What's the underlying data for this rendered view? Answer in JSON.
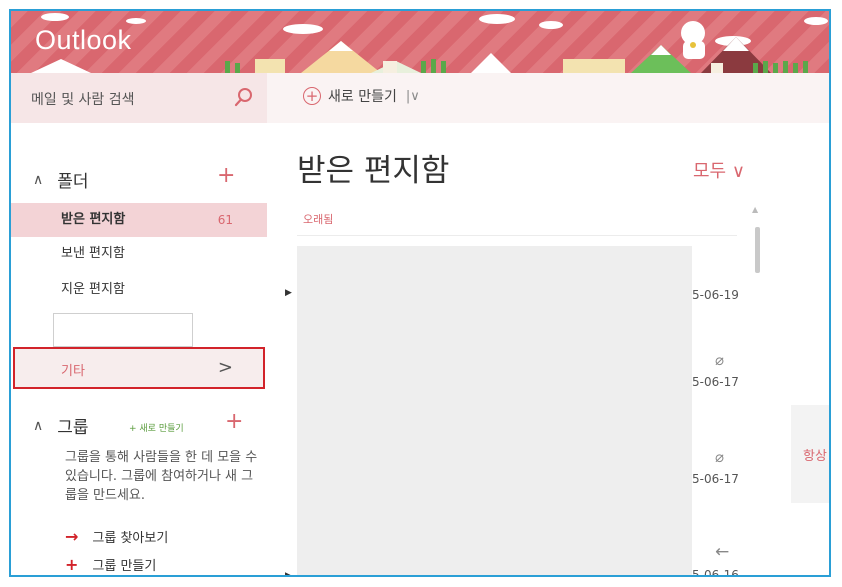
{
  "header": {
    "app_title": "Outlook"
  },
  "search": {
    "placeholder": "메일 및 사람 검색",
    "icon": "search-icon"
  },
  "toolbar": {
    "new_label": "새로 만들기"
  },
  "sidebar": {
    "folders_heading": "폴더",
    "folders": [
      {
        "label": "받은 편지함",
        "count": "61",
        "selected": true
      },
      {
        "label": "보낸 편지함"
      },
      {
        "label": "지운 편지함"
      }
    ],
    "other_label": "기타",
    "groups_heading": "그룹",
    "groups_new_label": "새로 만들기",
    "groups_description": "그룹을 통해 사람들을 한 데 모을 수 있습니다. 그룹에 참여하거나 새 그룹을 만드세요.",
    "find_groups_label": "그룹 찾아보기",
    "create_group_label": "그룹 만들기"
  },
  "message_list": {
    "title": "받은 편지함",
    "filter_label": "모두",
    "group_label": "오래됨",
    "rows": [
      {
        "date": "5-06-19",
        "attachment": false
      },
      {
        "date": "5-06-17",
        "attachment": true
      },
      {
        "date": "5-06-17",
        "attachment": true
      },
      {
        "date": "5-06-16",
        "attachment": false
      }
    ]
  },
  "reading_pane": {
    "text": "항상"
  },
  "colors": {
    "accent": "#d9676f",
    "header_stripe": "#e07a80",
    "highlight_border": "#d2232a",
    "frame_border": "#2a9fd6"
  }
}
